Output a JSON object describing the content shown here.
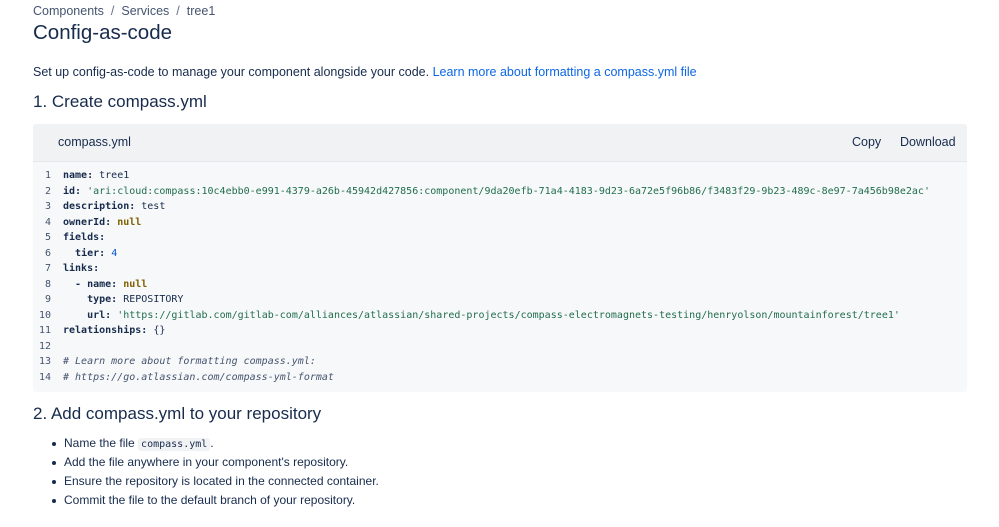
{
  "breadcrumb": [
    "Components",
    "Services",
    "tree1"
  ],
  "breadcrumb_separator": "/",
  "page": {
    "title": "Config-as-code",
    "intro_text": "Set up config-as-code to manage your component alongside your code.",
    "intro_link": "Learn more about formatting a compass.yml file"
  },
  "steps": {
    "step1_title": "1. Create compass.yml",
    "step2_title": "2. Add compass.yml to your repository"
  },
  "code_card": {
    "file_name": "compass.yml",
    "copy_label": "Copy",
    "download_label": "Download",
    "lines": [
      [
        [
          "k",
          "name:"
        ],
        [
          "p",
          " tree1"
        ]
      ],
      [
        [
          "k",
          "id:"
        ],
        [
          "p",
          " "
        ],
        [
          "s",
          "'ari:cloud:compass:10c4ebb0-e991-4379-a26b-45942d427856:component/9da20efb-71a4-4183-9d23-6a72e5f96b86/f3483f29-9b23-489c-8e97-7a456b98e2ac'"
        ]
      ],
      [
        [
          "k",
          "description:"
        ],
        [
          "p",
          " test"
        ]
      ],
      [
        [
          "k",
          "ownerId:"
        ],
        [
          "p",
          " "
        ],
        [
          "nl",
          "null"
        ]
      ],
      [
        [
          "k",
          "fields:"
        ]
      ],
      [
        [
          "p",
          "  "
        ],
        [
          "k",
          "tier:"
        ],
        [
          "p",
          " "
        ],
        [
          "n",
          "4"
        ]
      ],
      [
        [
          "k",
          "links:"
        ]
      ],
      [
        [
          "p",
          "  "
        ],
        [
          "k",
          "- name:"
        ],
        [
          "p",
          " "
        ],
        [
          "nl",
          "null"
        ]
      ],
      [
        [
          "p",
          "    "
        ],
        [
          "k",
          "type:"
        ],
        [
          "p",
          " REPOSITORY"
        ]
      ],
      [
        [
          "p",
          "    "
        ],
        [
          "k",
          "url:"
        ],
        [
          "p",
          " "
        ],
        [
          "s",
          "'https://gitlab.com/gitlab-com/alliances/atlassian/shared-projects/compass-electromagnets-testing/henryolson/mountainforest/tree1'"
        ]
      ],
      [
        [
          "k",
          "relationships:"
        ],
        [
          "p",
          " {}"
        ]
      ],
      [],
      [
        [
          "c",
          "# Learn more about formatting compass.yml:"
        ]
      ],
      [
        [
          "c",
          "# https://go.atlassian.com/compass-yml-format"
        ]
      ]
    ]
  },
  "instructions": [
    [
      [
        "t",
        "Name the file "
      ],
      [
        "code",
        "compass.yml"
      ],
      [
        "t",
        "."
      ]
    ],
    [
      [
        "t",
        "Add the file anywhere in your component's repository."
      ]
    ],
    [
      [
        "t",
        "Ensure the repository is located in the connected container."
      ]
    ],
    [
      [
        "t",
        "Commit the file to the default branch of your repository."
      ]
    ]
  ]
}
